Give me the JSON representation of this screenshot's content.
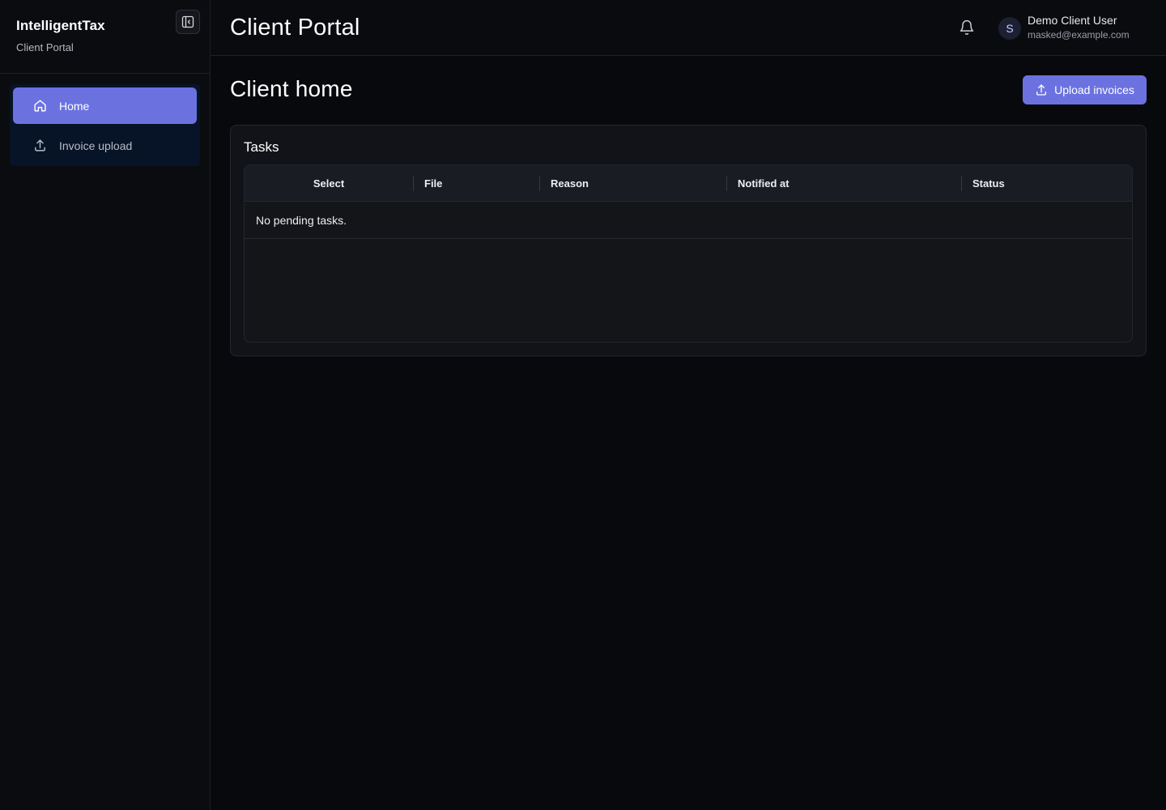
{
  "sidebar": {
    "brand_name": "IntelligentTax",
    "brand_subtitle": "Client Portal",
    "items": [
      {
        "label": "Home",
        "icon": "home-icon",
        "active": true
      },
      {
        "label": "Invoice upload",
        "icon": "upload-icon",
        "active": false
      }
    ]
  },
  "header": {
    "title": "Client Portal",
    "user": {
      "initial": "S",
      "name": "Demo Client User",
      "email": "masked@example.com"
    }
  },
  "main": {
    "page_title": "Client home",
    "upload_button_label": "Upload invoices",
    "tasks": {
      "title": "Tasks",
      "columns": [
        "Select",
        "File",
        "Reason",
        "Notified at",
        "Status"
      ],
      "empty_message": "No pending tasks."
    }
  },
  "colors": {
    "accent": "#6b72e0",
    "background": "#08090c",
    "sidebar_nav_bg": "#071427"
  }
}
